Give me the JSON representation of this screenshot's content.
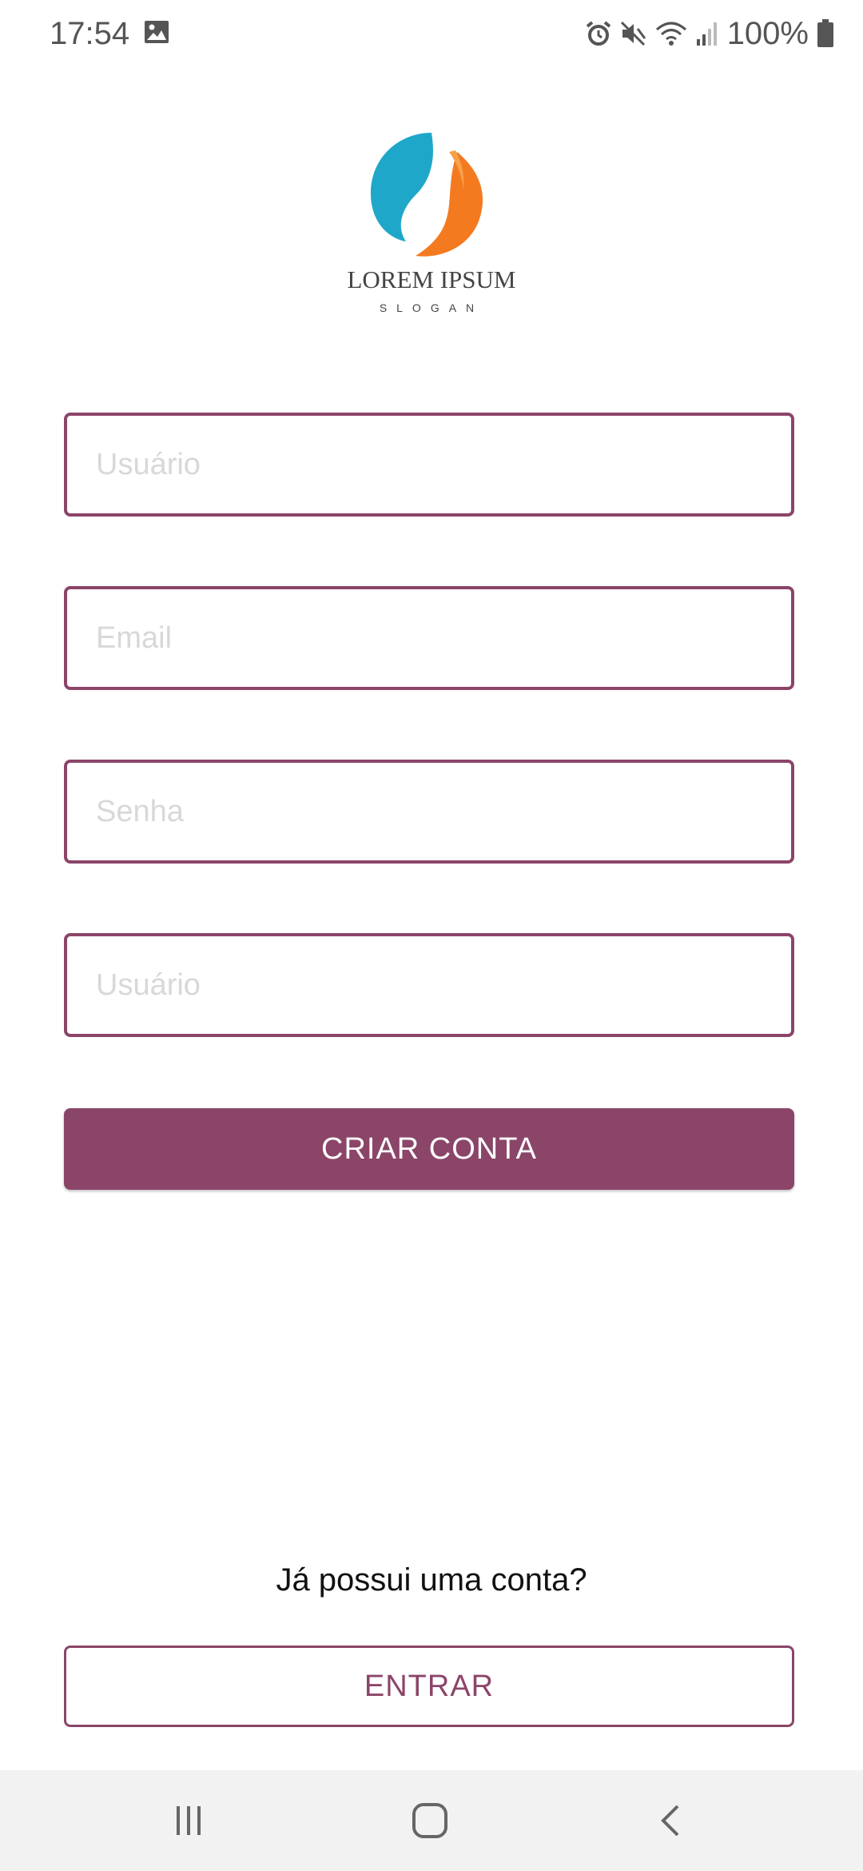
{
  "status_bar": {
    "time": "17:54",
    "battery": "100%",
    "icons": [
      "gallery-icon",
      "alarm-icon",
      "mute-icon",
      "wifi-icon",
      "signal-icon",
      "battery-icon"
    ]
  },
  "logo": {
    "title": "LOREM IPSUM",
    "slogan": "SLOGAN",
    "colors": {
      "blue": "#1ea7c9",
      "orange": "#f47a20"
    }
  },
  "form": {
    "fields": [
      {
        "placeholder": "Usuário",
        "value": ""
      },
      {
        "placeholder": "Email",
        "value": ""
      },
      {
        "placeholder": "Senha",
        "value": ""
      },
      {
        "placeholder": "Usuário",
        "value": ""
      }
    ],
    "submit_label": "CRIAR CONTA"
  },
  "footer": {
    "question": "Já possui uma conta?",
    "login_label": "ENTRAR"
  },
  "nav_bar": {
    "icons": [
      "recent-apps-icon",
      "home-icon",
      "back-icon"
    ]
  },
  "colors": {
    "accent": "#8b4568",
    "placeholder": "#d8d8d8",
    "nav_background": "#f2f2f2"
  }
}
